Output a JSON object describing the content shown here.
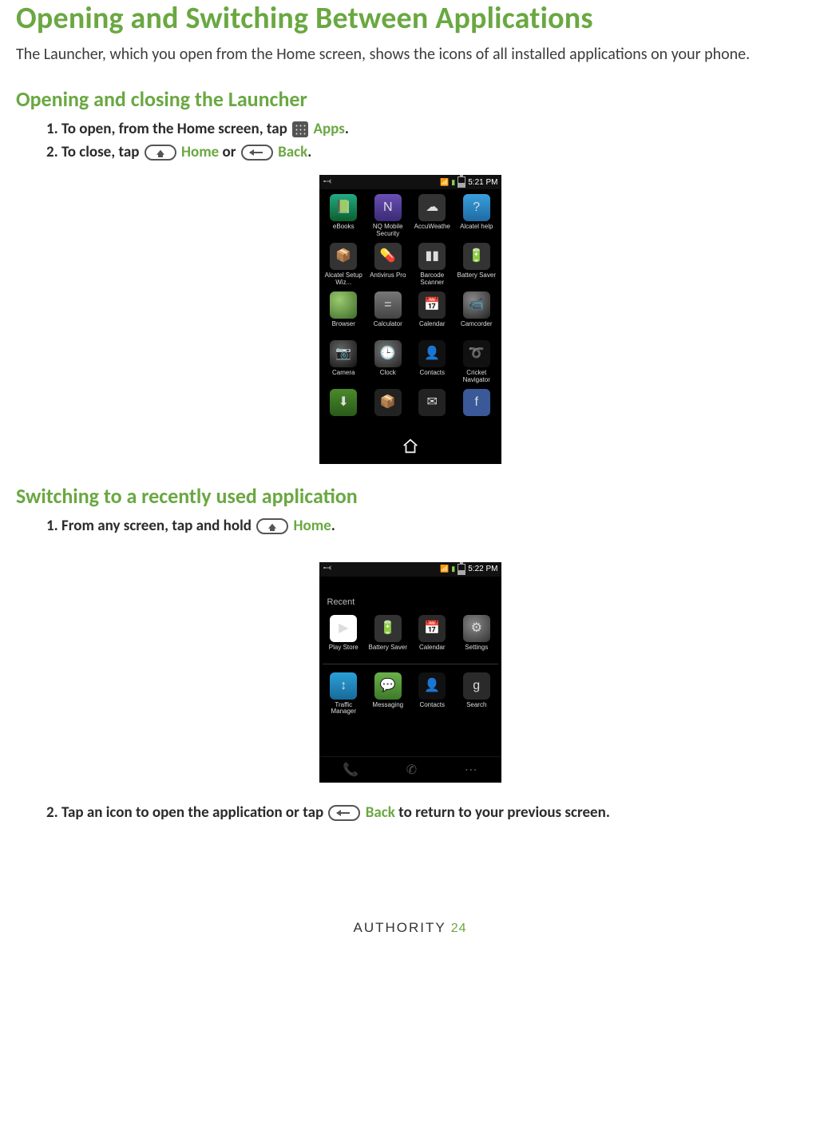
{
  "title": "Opening and Switching Between Applications",
  "intro": "The Launcher, which you open from the Home screen, shows the icons of all installed applications on your phone.",
  "section1": {
    "heading": "Opening and closing the Launcher",
    "step1_a": "1. To open, from the Home screen, tap ",
    "step1_apps": "Apps",
    "step1_end": ".",
    "step2_a": "2. To close, tap ",
    "step2_home": "Home",
    "step2_or": " or ",
    "step2_back": "Back",
    "step2_end": "."
  },
  "section2": {
    "heading": "Switching to a recently used application",
    "step1_a": "1. From any screen, tap and hold ",
    "step1_home": "Home",
    "step1_end": ".",
    "step2_a": "2. Tap an icon to open the application or tap ",
    "step2_back": "Back",
    "step2_b": " to return to your previous screen."
  },
  "phone1": {
    "time": "5:21 PM",
    "apps": [
      {
        "label": "eBooks",
        "color": "c-green",
        "glyph": "📗"
      },
      {
        "label": "NQ Mobile Security",
        "color": "c-purple",
        "glyph": "N"
      },
      {
        "label": "AccuWeathe",
        "color": "c-cloud",
        "glyph": "☁"
      },
      {
        "label": "Alcatel help",
        "color": "c-blue",
        "glyph": "?"
      },
      {
        "label": "Alcatel Setup Wiz...",
        "color": "c-box",
        "glyph": "📦"
      },
      {
        "label": "Antivirus Pro",
        "color": "c-pill",
        "glyph": "💊"
      },
      {
        "label": "Barcode Scanner",
        "color": "c-dark",
        "glyph": "▮▮"
      },
      {
        "label": "Battery Saver",
        "color": "c-yellow",
        "glyph": "🔋"
      },
      {
        "label": "Browser",
        "color": "c-globe",
        "glyph": ""
      },
      {
        "label": "Calculator",
        "color": "c-calc",
        "glyph": "="
      },
      {
        "label": "Calendar",
        "color": "c-cal",
        "glyph": "📅"
      },
      {
        "label": "Camcorder",
        "color": "c-cam",
        "glyph": "📹"
      },
      {
        "label": "Camera",
        "color": "c-lens",
        "glyph": "📷"
      },
      {
        "label": "Clock",
        "color": "c-clock",
        "glyph": "🕒"
      },
      {
        "label": "Contacts",
        "color": "c-contact",
        "glyph": "👤"
      },
      {
        "label": "Cricket Navigator",
        "color": "c-nav",
        "glyph": "➰"
      },
      {
        "label": "",
        "color": "c-dl",
        "glyph": "⬇"
      },
      {
        "label": "",
        "color": "c-cube",
        "glyph": "📦"
      },
      {
        "label": "",
        "color": "c-email",
        "glyph": "✉"
      },
      {
        "label": "",
        "color": "c-fb",
        "glyph": "f"
      }
    ]
  },
  "phone2": {
    "time": "5:22 PM",
    "recent_label": "Recent",
    "apps_row1": [
      {
        "label": "Play Store",
        "color": "c-store",
        "glyph": "▶"
      },
      {
        "label": "Battery Saver",
        "color": "c-yellow",
        "glyph": "🔋"
      },
      {
        "label": "Calendar",
        "color": "c-cal",
        "glyph": "📅"
      },
      {
        "label": "Settings",
        "color": "c-set",
        "glyph": "⚙"
      }
    ],
    "apps_row2": [
      {
        "label": "Traffic Manager",
        "color": "c-tm",
        "glyph": "↕"
      },
      {
        "label": "Messaging",
        "color": "c-msg",
        "glyph": "💬"
      },
      {
        "label": "Contacts",
        "color": "c-contact",
        "glyph": "👤"
      },
      {
        "label": "Search",
        "color": "c-search",
        "glyph": "g"
      }
    ]
  },
  "footer": {
    "brand": "AUTHORITY",
    "page": "24"
  }
}
